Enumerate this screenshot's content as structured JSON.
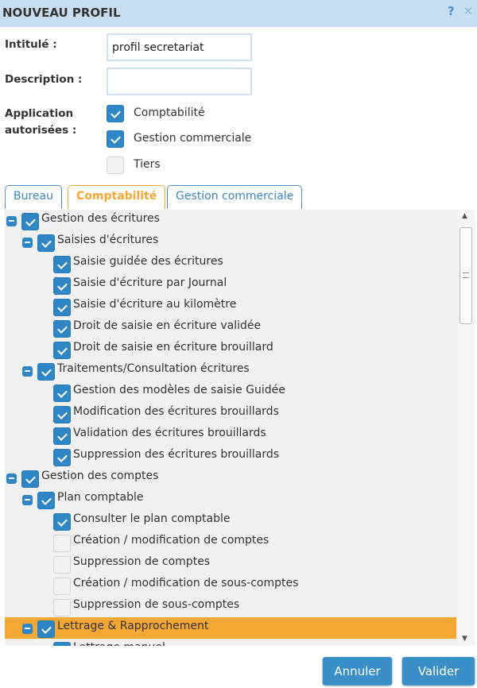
{
  "window": {
    "title": "NOUVEAU PROFIL",
    "help": "?",
    "close": "×"
  },
  "form": {
    "intitule_label": "Intitulé :",
    "intitule_value": "profil secretariat",
    "description_label": "Description :",
    "description_value": "",
    "apps_label_1": "Application",
    "apps_label_2": "autorisées :",
    "apps": [
      {
        "label": "Comptabilité",
        "checked": true
      },
      {
        "label": "Gestion commerciale",
        "checked": true
      },
      {
        "label": "Tiers",
        "checked": false
      }
    ]
  },
  "tabs": [
    {
      "label": "Bureau",
      "active": false
    },
    {
      "label": "Comptabilité",
      "active": true
    },
    {
      "label": "Gestion commerciale",
      "active": false
    }
  ],
  "tree": [
    {
      "label": "Gestion des écritures",
      "level": 0,
      "state": "checked",
      "expandable": true
    },
    {
      "label": "Saisies d'écritures",
      "level": 1,
      "state": "checked",
      "expandable": true
    },
    {
      "label": "Saisie guidée des écritures",
      "level": 2,
      "state": "checked"
    },
    {
      "label": "Saisie d'écriture par Journal",
      "level": 2,
      "state": "checked"
    },
    {
      "label": "Saisie d'écriture au kilomètre",
      "level": 2,
      "state": "checked"
    },
    {
      "label": "Droit de saisie en écriture validée",
      "level": 2,
      "state": "checked"
    },
    {
      "label": "Droit de saisie en écriture brouillard",
      "level": 2,
      "state": "checked"
    },
    {
      "label": "Traitements/Consultation écritures",
      "level": 1,
      "state": "checked",
      "expandable": true
    },
    {
      "label": "Gestion des modèles de saisie Guidée",
      "level": 2,
      "state": "checked"
    },
    {
      "label": "Modification des écritures brouillards",
      "level": 2,
      "state": "checked"
    },
    {
      "label": "Validation des écritures brouillards",
      "level": 2,
      "state": "checked"
    },
    {
      "label": "Suppression des écritures brouillards",
      "level": 2,
      "state": "checked"
    },
    {
      "label": "Gestion des comptes",
      "level": 0,
      "state": "partial",
      "expandable": true
    },
    {
      "label": "Plan comptable",
      "level": 1,
      "state": "partial",
      "expandable": true
    },
    {
      "label": "Consulter le plan comptable",
      "level": 2,
      "state": "checked"
    },
    {
      "label": "Création / modification de comptes",
      "level": 2,
      "state": "off"
    },
    {
      "label": "Suppression de comptes",
      "level": 2,
      "state": "off"
    },
    {
      "label": "Création / modification de sous-comptes",
      "level": 2,
      "state": "off"
    },
    {
      "label": "Suppression de sous-comptes",
      "level": 2,
      "state": "off"
    },
    {
      "label": "Lettrage & Rapprochement",
      "level": 1,
      "state": "checked",
      "expandable": true,
      "selected": true
    },
    {
      "label": "Lettrage manuel",
      "level": 2,
      "state": "checked"
    }
  ],
  "buttons": {
    "cancel": "Annuler",
    "ok": "Valider"
  },
  "colors": {
    "accent": "#2f86c6",
    "selected": "#f5a733",
    "titlebar": "#c9ddf0"
  }
}
